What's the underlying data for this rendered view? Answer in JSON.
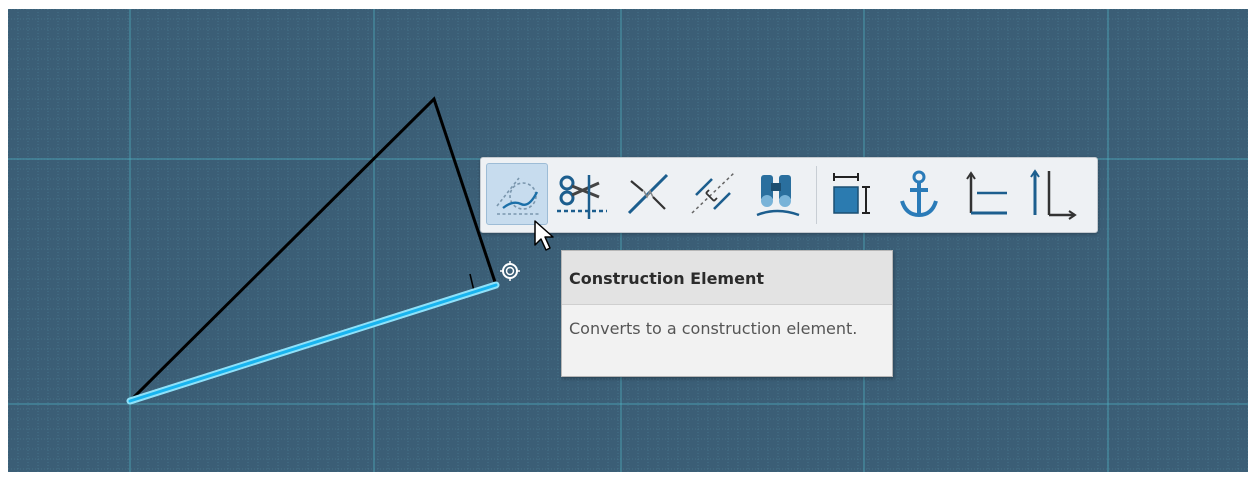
{
  "canvas": {
    "background": "#3b5e76",
    "grid_color": "#4f8196",
    "axis_color": "#4fb7c9"
  },
  "sketch": {
    "line_color": "#000000",
    "selected_color": "#19b4ef"
  },
  "toolbar": {
    "buttons": [
      {
        "icon": "construction-element-icon",
        "active": true
      },
      {
        "icon": "quick-trim-icon",
        "active": false
      },
      {
        "icon": "break-icon",
        "active": false
      },
      {
        "icon": "symmetry-icon",
        "active": false
      },
      {
        "icon": "project-3d-elements-icon",
        "active": false
      },
      {
        "icon": "constraint-dimension-icon",
        "active": false
      },
      {
        "icon": "fix-together-icon",
        "active": false
      },
      {
        "icon": "horizontal-constraint-icon",
        "active": false
      },
      {
        "icon": "perpendicular-constraint-icon",
        "active": false
      }
    ]
  },
  "tooltip": {
    "title": "Construction Element",
    "description": "Converts to a construction element."
  }
}
